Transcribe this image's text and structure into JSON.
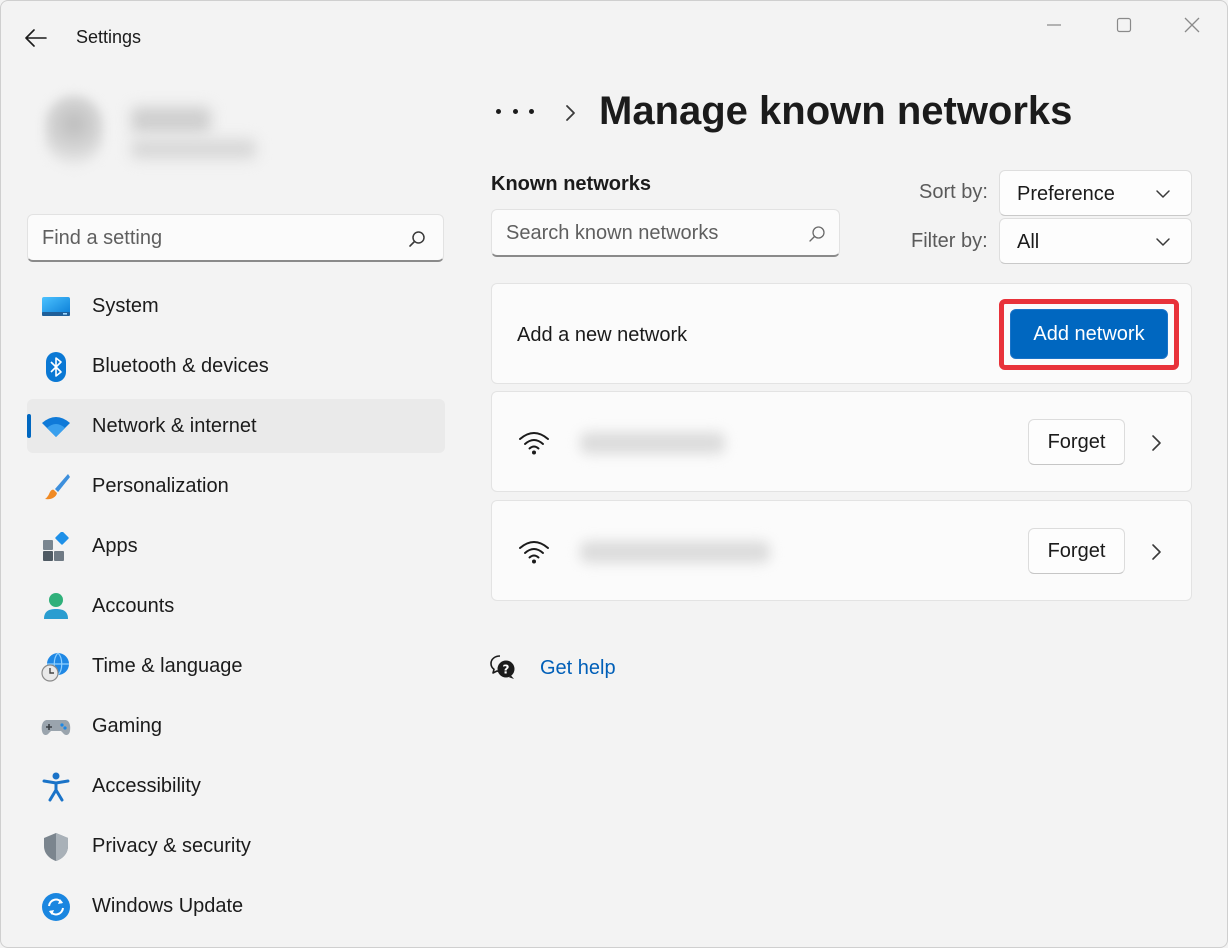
{
  "window": {
    "app_title": "Settings",
    "controls": [
      "minimize-icon",
      "maximize-icon",
      "close-icon"
    ]
  },
  "sidebar": {
    "search_placeholder": "Find a setting",
    "items": [
      {
        "label": "System",
        "icon": "system-icon"
      },
      {
        "label": "Bluetooth & devices",
        "icon": "bluetooth-icon"
      },
      {
        "label": "Network & internet",
        "icon": "wifi-icon",
        "active": true
      },
      {
        "label": "Personalization",
        "icon": "paintbrush-icon"
      },
      {
        "label": "Apps",
        "icon": "apps-icon"
      },
      {
        "label": "Accounts",
        "icon": "person-icon"
      },
      {
        "label": "Time & language",
        "icon": "globe-clock-icon"
      },
      {
        "label": "Gaming",
        "icon": "gamepad-icon"
      },
      {
        "label": "Accessibility",
        "icon": "accessibility-icon"
      },
      {
        "label": "Privacy & security",
        "icon": "shield-icon"
      },
      {
        "label": "Windows Update",
        "icon": "sync-icon"
      }
    ]
  },
  "main": {
    "page_title": "Manage known networks",
    "section_label": "Known networks",
    "search_placeholder": "Search known networks",
    "sort": {
      "label": "Sort by:",
      "value": "Preference"
    },
    "filter": {
      "label": "Filter by:",
      "value": "All"
    },
    "add_network": {
      "label": "Add a new network",
      "button": "Add network"
    },
    "networks": [
      {
        "forget": "Forget"
      },
      {
        "forget": "Forget"
      }
    ],
    "help_link": "Get help"
  },
  "colors": {
    "accent": "#0067c0",
    "highlight": "#e8323a",
    "link": "#005fb8",
    "background": "#f3f3f3"
  }
}
